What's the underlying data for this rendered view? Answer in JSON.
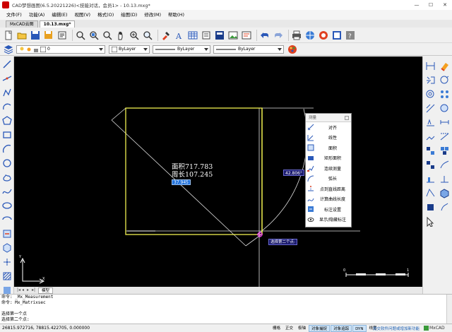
{
  "window": {
    "title": "CAD梦想画图(6.5.20221226)<技能对话，会员1> - 10.13.mxg*",
    "minimize": "—",
    "maximize": "☐",
    "close": "✕"
  },
  "menu": [
    "文件(F)",
    "功能(A)",
    "编辑(E)",
    "视图(V)",
    "格式(O)",
    "绘图(D)",
    "修改(M)",
    "帮助(H)"
  ],
  "doc_tabs": [
    {
      "label": "MxCAD云图",
      "active": false
    },
    {
      "label": "10.13.mxg*",
      "active": true
    }
  ],
  "toolbar1_icons": [
    "new-file",
    "open-folder",
    "save",
    "save-as",
    "undo-history",
    "zoom-window",
    "zoom-extents",
    "zoom-previous",
    "pan-hand",
    "zoom-realtime",
    "zoom-in",
    "match-properties",
    "text-style",
    "table",
    "sheet-set",
    "layer-states",
    "image",
    "print-preview",
    "undo",
    "redo",
    "print",
    "publish",
    "web",
    "cloud-share",
    "help"
  ],
  "layer_bar": {
    "layer_value": "0",
    "color_value": "ByLayer",
    "linetype_value": "ByLayer",
    "lineweight_value": "ByLayer"
  },
  "left_tools": [
    "line",
    "construction-line",
    "polyline",
    "arc",
    "polygon",
    "rectangle",
    "arc-3pt",
    "circle",
    "revision-cloud",
    "spline",
    "ellipse",
    "ellipse-arc",
    "insert-block",
    "make-block",
    "point",
    "hatch",
    "gradient",
    "region",
    "table-insert",
    "multiline-text"
  ],
  "right_tools": [
    "dimension",
    "erase",
    "copy",
    "mirror",
    "offset",
    "array",
    "move",
    "rotate",
    "scale",
    "stretch",
    "trim",
    "extend",
    "break-at-point",
    "break",
    "join",
    "chamfer",
    "fillet",
    "blend",
    "explode",
    "3d-box",
    "solid-edit",
    "properties",
    "cursor"
  ],
  "canvas": {
    "area_label": "面积717.783",
    "perimeter_label": "周长107.245",
    "dim_input": "37.945",
    "angle_tip": "42.806°",
    "prompt_tip": "选择第二个点:",
    "scale_bar_start": "0",
    "scale_bar_end": "1"
  },
  "measure_panel": {
    "title": "测量",
    "items": [
      {
        "label": "对齐",
        "icon": "align-dim-icon"
      },
      {
        "label": "线性",
        "icon": "linear-dim-icon"
      },
      {
        "label": "面积",
        "icon": "area-icon"
      },
      {
        "label": "矩形面积",
        "icon": "rect-area-icon"
      },
      {
        "label": "连续测量",
        "icon": "continuous-measure-icon"
      },
      {
        "label": "弧长",
        "icon": "arc-length-icon"
      },
      {
        "label": "点到直线距离",
        "icon": "point-line-distance-icon"
      },
      {
        "label": "计算曲线长度",
        "icon": "curve-length-icon"
      },
      {
        "label": "标注设置",
        "icon": "dim-settings-icon"
      },
      {
        "label": "显示/隐藏标注",
        "icon": "toggle-dim-icon"
      }
    ]
  },
  "layout_tabs": {
    "model": "模型"
  },
  "command_lines": [
    "命令: _Mx_Measurement",
    "命令: Mx_Matrixsec",
    "",
    "选择第一个点",
    "选择第二个点:"
  ],
  "status": {
    "coords": "26815.972716,  78815.422705,  0.000000",
    "toggles": [
      {
        "label": "栅格",
        "on": false
      },
      {
        "label": "正交",
        "on": false
      },
      {
        "label": "极轴",
        "on": false
      },
      {
        "label": "对象捕捉",
        "on": true
      },
      {
        "label": "对象追踪",
        "on": true
      },
      {
        "label": "DYN",
        "on": true
      },
      {
        "label": "线宽",
        "on": false
      }
    ],
    "brand_text": "提交软件问题或增加新功能",
    "brand_logo": "MxCAD"
  },
  "colors": {
    "canvas_bg": "#000000",
    "rect_yellow": "#f0f050",
    "measure_line": "#d8d8d8",
    "accent_blue": "#1e6fd9"
  }
}
